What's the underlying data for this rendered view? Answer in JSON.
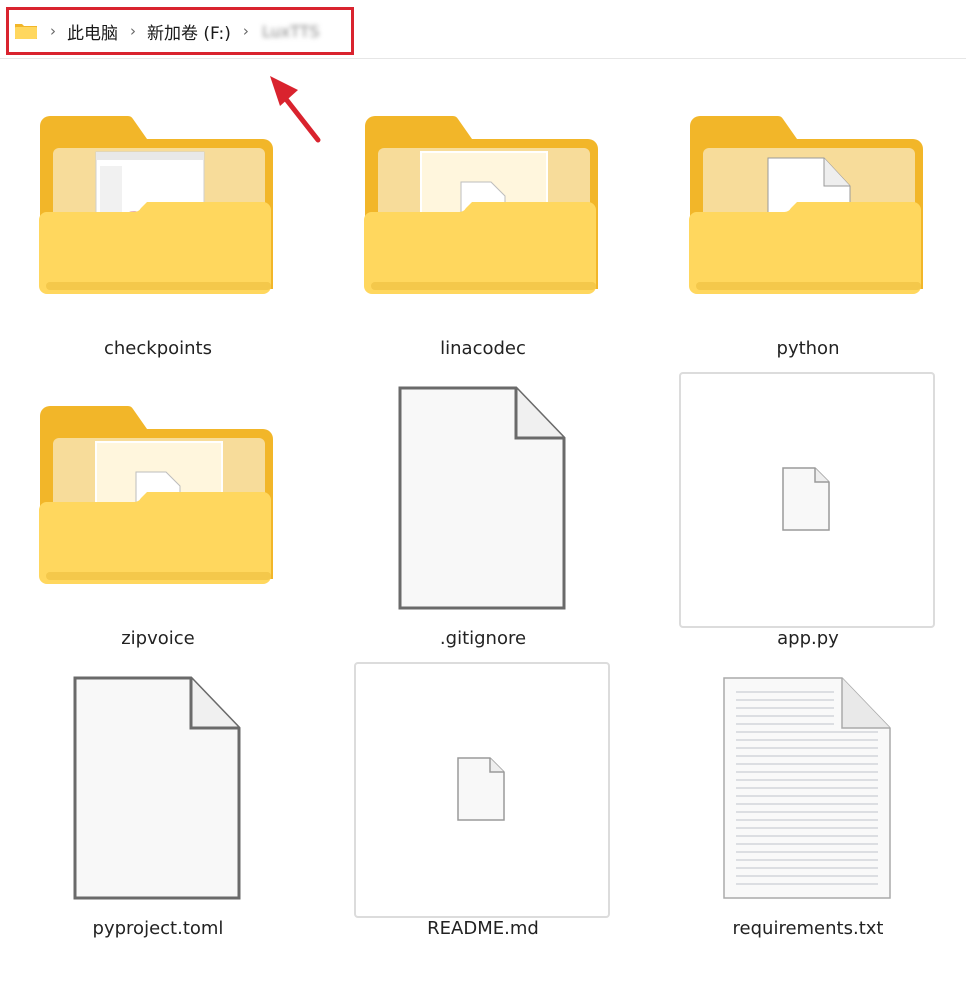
{
  "breadcrumb": {
    "items": [
      "此电脑",
      "新加卷 (F:)",
      "LuxTTS"
    ]
  },
  "items": [
    {
      "name": "checkpoints",
      "type": "folder"
    },
    {
      "name": "linacodec",
      "type": "folder"
    },
    {
      "name": "python",
      "type": "folder"
    },
    {
      "name": "zipvoice",
      "type": "folder"
    },
    {
      "name": ".gitignore",
      "type": "file"
    },
    {
      "name": "app.py",
      "type": "file"
    },
    {
      "name": "pyproject.toml",
      "type": "file"
    },
    {
      "name": "README.md",
      "type": "file"
    },
    {
      "name": "requirements.txt",
      "type": "file"
    }
  ],
  "colors": {
    "highlight": "#d9232e",
    "folder_back": "#f2b629",
    "folder_front": "#ffd75e"
  }
}
